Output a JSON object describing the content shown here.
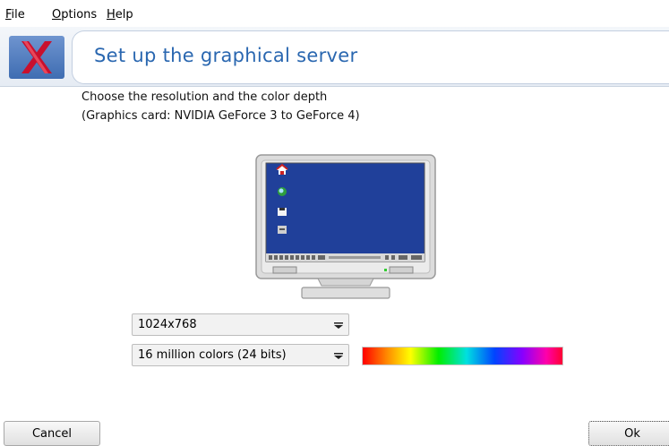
{
  "menubar": {
    "file": {
      "mnemonic": "F",
      "rest": "ile"
    },
    "options": {
      "mnemonic": "O",
      "rest": "ptions"
    },
    "help": {
      "mnemonic": "H",
      "rest": "elp"
    }
  },
  "banner": {
    "title": "Set up the graphical server",
    "icon": "xfree86-x-icon"
  },
  "description": {
    "line1": "Choose the resolution and the color depth",
    "line2": "(Graphics card: NVIDIA GeForce 3 to GeForce 4)"
  },
  "preview": {
    "icon": "monitor-preview-icon"
  },
  "resolution": {
    "value": "1024x768"
  },
  "color_depth": {
    "value": "16 million colors (24 bits)"
  },
  "buttons": {
    "cancel": "Cancel",
    "ok": "Ok"
  },
  "colors": {
    "accent": "#2a67b0",
    "desktop": "#20409a"
  }
}
